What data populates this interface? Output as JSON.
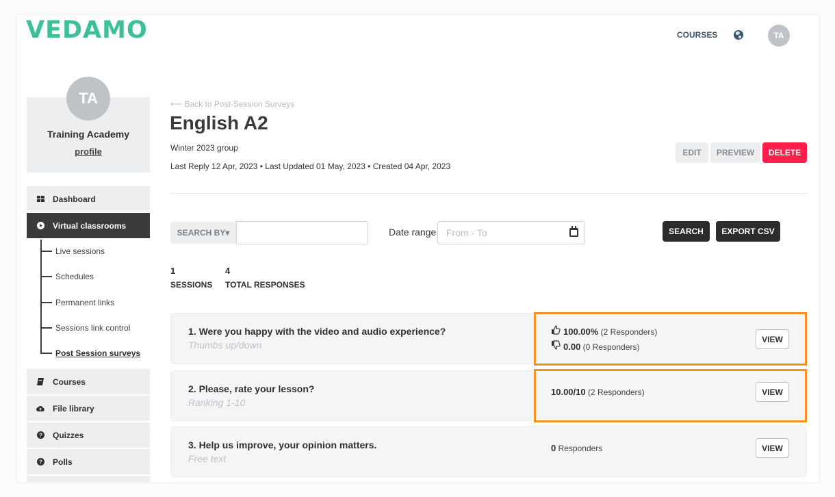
{
  "header": {
    "logo": "VEDAMO",
    "nav_courses": "COURSES",
    "language_icon": "globe-icon",
    "user_initials": "TA"
  },
  "sidebar": {
    "profile": {
      "initials": "TA",
      "name": "Training Academy",
      "link": "profile"
    },
    "items": [
      {
        "label": "Dashboard",
        "icon": "grid-icon"
      },
      {
        "label": "Virtual classrooms",
        "icon": "play-circle-icon",
        "active": true
      },
      {
        "label": "Courses",
        "icon": "book-icon"
      },
      {
        "label": "File library",
        "icon": "cloud-upload-icon"
      },
      {
        "label": "Quizzes",
        "icon": "question-circle-icon"
      },
      {
        "label": "Polls",
        "icon": "question-circle-icon"
      }
    ],
    "subitems": [
      {
        "label": "Live sessions"
      },
      {
        "label": "Schedules"
      },
      {
        "label": "Permanent links"
      },
      {
        "label": "Sessions link control"
      },
      {
        "label": "Post Session surveys",
        "active": true
      }
    ]
  },
  "page": {
    "back_link": "⟵ Back to Post-Session Surveys",
    "title": "English A2",
    "subtitle": "Winter 2023 group",
    "meta": "Last Reply 12 Apr, 2023 • Last Updated 01 May, 2023 • Created 04 Apr, 2023",
    "actions": {
      "edit": "EDIT",
      "preview": "PREVIEW",
      "delete": "DELETE"
    }
  },
  "filters": {
    "search_by": "SEARCH BY▾",
    "search_value": "",
    "date_label": "Date range",
    "date_placeholder": "From - To",
    "search_button": "SEARCH",
    "export_button": "EXPORT CSV"
  },
  "stats": {
    "sessions": {
      "value": "1",
      "label": "SESSIONS"
    },
    "responses": {
      "value": "4",
      "label": "TOTAL RESPONSES"
    }
  },
  "questions": [
    {
      "title": "1. Were you happy with the video and audio experience?",
      "type": "Thumbs up/down",
      "up_value": "100.00%",
      "up_responders": "(2 Responders)",
      "down_value": "0.00",
      "down_responders": "(0 Responders)",
      "view": "VIEW",
      "highlighted": true
    },
    {
      "title": "2. Please, rate your lesson?",
      "type": "Ranking 1-10",
      "score": "10.00/10",
      "responders": "(2 Responders)",
      "view": "VIEW",
      "highlighted": true
    },
    {
      "title": "3. Help us improve, your opinion matters.",
      "type": "Free text",
      "count": "0",
      "responders": "Responders",
      "view": "VIEW",
      "highlighted": false
    }
  ],
  "colors": {
    "brand": "#3dbf9a",
    "delete": "#ff1f4b",
    "highlight": "#f7931e",
    "active_menu": "#3b3b3b"
  }
}
